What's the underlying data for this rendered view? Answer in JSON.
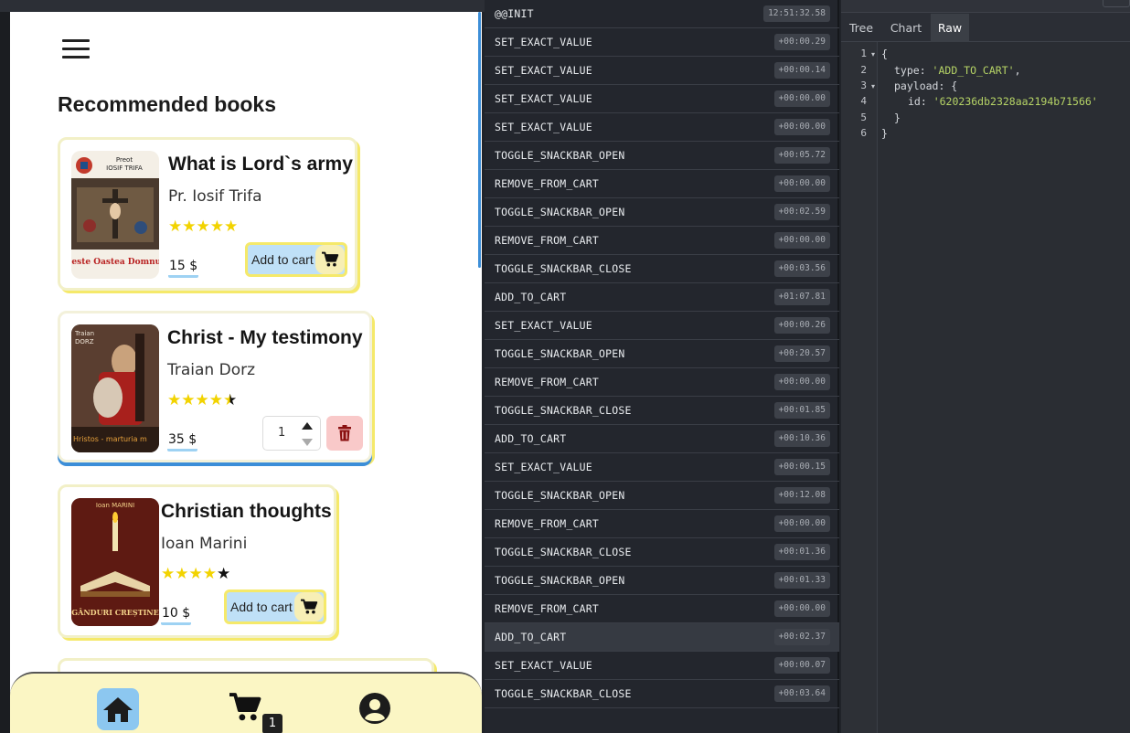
{
  "app": {
    "section_title": "Recommended books",
    "books": [
      {
        "title": "What is Lord`s army",
        "author": "Pr. Iosif Trifa",
        "rating": 5,
        "price": "15 $",
        "action_label": "Add to cart",
        "cover_text_top": "Preot\nIOSIF TRIFA",
        "cover_text_bottom": "Ce este Oastea Domnului"
      },
      {
        "title": "Christ - My testimony",
        "author": "Traian Dorz",
        "rating": 4.5,
        "price": "35 $",
        "quantity": "1",
        "cover_text_top": "Traian\nDORZ",
        "cover_text_bottom": "Hristos - marturia m"
      },
      {
        "title": "Christian thoughts",
        "author": "Ioan Marini",
        "rating": 4,
        "price": "10 $",
        "action_label": "Add to cart",
        "cover_text_top": "Ioan MARINI",
        "cover_text_bottom": "GÂNDURI CREȘTINE"
      }
    ],
    "nav": {
      "cart_badge": "1"
    },
    "colors": {
      "accent_yellow": "#f5e96a",
      "accent_blue": "#8cc7f0",
      "nav_bg": "#fbf6c4",
      "delete_bg": "#f9c9c9"
    }
  },
  "devtools": {
    "actions": [
      {
        "name": "@@INIT",
        "time": "12:51:32.58"
      },
      {
        "name": "SET_EXACT_VALUE",
        "time": "+00:00.29"
      },
      {
        "name": "SET_EXACT_VALUE",
        "time": "+00:00.14"
      },
      {
        "name": "SET_EXACT_VALUE",
        "time": "+00:00.00"
      },
      {
        "name": "SET_EXACT_VALUE",
        "time": "+00:00.00"
      },
      {
        "name": "TOGGLE_SNACKBAR_OPEN",
        "time": "+00:05.72"
      },
      {
        "name": "REMOVE_FROM_CART",
        "time": "+00:00.00"
      },
      {
        "name": "TOGGLE_SNACKBAR_OPEN",
        "time": "+00:02.59"
      },
      {
        "name": "REMOVE_FROM_CART",
        "time": "+00:00.00"
      },
      {
        "name": "TOGGLE_SNACKBAR_CLOSE",
        "time": "+00:03.56"
      },
      {
        "name": "ADD_TO_CART",
        "time": "+01:07.81"
      },
      {
        "name": "SET_EXACT_VALUE",
        "time": "+00:00.26"
      },
      {
        "name": "TOGGLE_SNACKBAR_OPEN",
        "time": "+00:20.57"
      },
      {
        "name": "REMOVE_FROM_CART",
        "time": "+00:00.00"
      },
      {
        "name": "TOGGLE_SNACKBAR_CLOSE",
        "time": "+00:01.85"
      },
      {
        "name": "ADD_TO_CART",
        "time": "+00:10.36"
      },
      {
        "name": "SET_EXACT_VALUE",
        "time": "+00:00.15"
      },
      {
        "name": "TOGGLE_SNACKBAR_OPEN",
        "time": "+00:12.08"
      },
      {
        "name": "REMOVE_FROM_CART",
        "time": "+00:00.00"
      },
      {
        "name": "TOGGLE_SNACKBAR_CLOSE",
        "time": "+00:01.36"
      },
      {
        "name": "TOGGLE_SNACKBAR_OPEN",
        "time": "+00:01.33"
      },
      {
        "name": "REMOVE_FROM_CART",
        "time": "+00:00.00"
      },
      {
        "name": "ADD_TO_CART",
        "time": "+00:02.37",
        "selected": true
      },
      {
        "name": "SET_EXACT_VALUE",
        "time": "+00:00.07"
      },
      {
        "name": "TOGGLE_SNACKBAR_CLOSE",
        "time": "+00:03.64"
      }
    ],
    "tabs": [
      {
        "label": "Tree"
      },
      {
        "label": "Chart"
      },
      {
        "label": "Raw",
        "active": true
      }
    ],
    "raw": {
      "line_numbers": [
        "1",
        "2",
        "3",
        "4",
        "5",
        "6"
      ],
      "open_brace": "{",
      "type_key": "type: ",
      "type_value": "'ADD_TO_CART'",
      "comma": ",",
      "payload_key": "payload: {",
      "id_key": "id: ",
      "id_value": "'620236db2328aa2194b71566'",
      "inner_close": "}",
      "outer_close": "}"
    }
  }
}
